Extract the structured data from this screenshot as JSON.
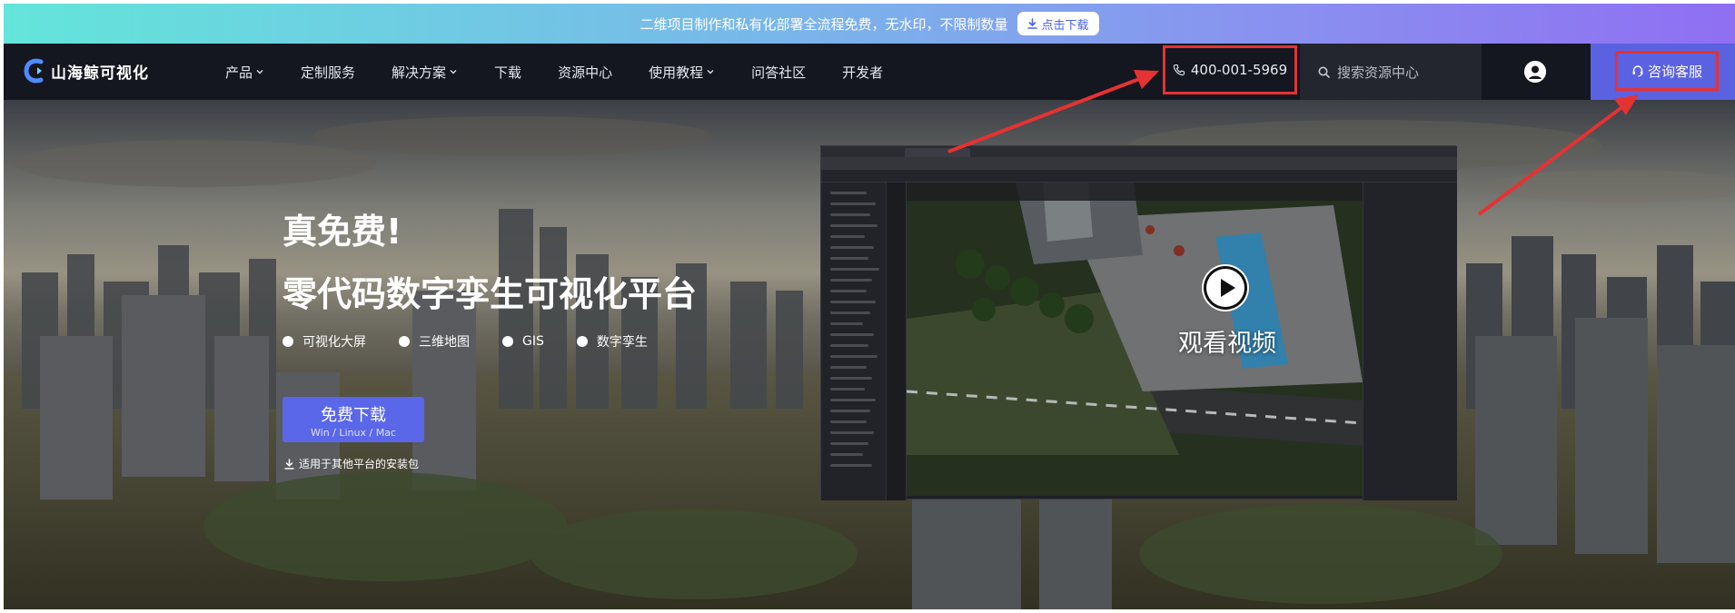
{
  "promo": {
    "text": "二维项目制作和私有化部署全流程免费，无水印，不限制数量",
    "button_label": "点击下载"
  },
  "nav": {
    "brand": "山海鲸可视化",
    "menu": [
      {
        "label": "产品",
        "has_dropdown": true
      },
      {
        "label": "定制服务",
        "has_dropdown": false
      },
      {
        "label": "解决方案",
        "has_dropdown": true
      },
      {
        "label": "下载",
        "has_dropdown": false
      },
      {
        "label": "资源中心",
        "has_dropdown": false
      },
      {
        "label": "使用教程",
        "has_dropdown": true
      },
      {
        "label": "问答社区",
        "has_dropdown": false
      },
      {
        "label": "开发者",
        "has_dropdown": false
      }
    ],
    "phone": "400-001-5969",
    "search_placeholder": "搜索资源中心",
    "consult_label": "咨询客服"
  },
  "hero": {
    "title_line1": "真免费!",
    "title_line2": "零代码数字孪生可视化平台",
    "tags": [
      "可视化大屏",
      "三维地图",
      "GIS",
      "数字孪生"
    ],
    "download_label": "免费下载",
    "download_platforms": "Win / Linux / Mac",
    "other_packages": "适用于其他平台的安装包",
    "video_label": "观看视频"
  },
  "colors": {
    "accent": "#5a67e8",
    "nav_bg": "#141620",
    "highlight_box": "#e53232",
    "arrow": "#e53232"
  },
  "icons": {
    "brand": "shanhaijing-logo-icon",
    "phone": "phone-icon",
    "search": "search-icon",
    "user": "user-avatar-icon",
    "headset": "headset-icon",
    "download": "download-icon",
    "play": "play-icon",
    "chevron": "chevron-down-icon"
  }
}
